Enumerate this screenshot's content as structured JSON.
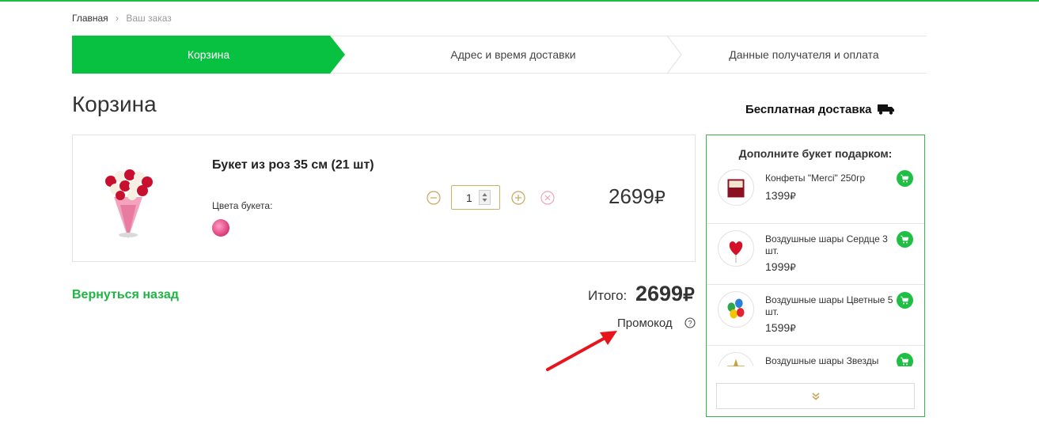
{
  "breadcrumb": {
    "home": "Главная",
    "current": "Ваш заказ"
  },
  "steps": [
    {
      "label": "Корзина",
      "active": true
    },
    {
      "label": "Адрес и время доставки",
      "active": false
    },
    {
      "label": "Данные получателя и оплата",
      "active": false
    }
  ],
  "page_title": "Корзина",
  "cart": {
    "product_name": "Букет из роз 35 см (21 шт)",
    "colors_label": "Цвета букета:",
    "quantity": "1",
    "price": "2699",
    "currency": "₽"
  },
  "footer": {
    "back_link": "Вернуться назад",
    "total_label": "Итого:",
    "total_value": "2699",
    "currency": "₽",
    "promo": "Промокод"
  },
  "delivery": {
    "text": "Бесплатная доставка"
  },
  "gifts": {
    "title": "Дополните букет подарком:",
    "items": [
      {
        "name": "Конфеты \"Merci\" 250гр",
        "price": "1399",
        "icon": "candy-box-icon"
      },
      {
        "name": "Воздушные шары Сердце 3 шт.",
        "price": "1999",
        "icon": "heart-balloons-icon"
      },
      {
        "name": "Воздушные шары Цветные 5 шт.",
        "price": "1599",
        "icon": "color-balloons-icon"
      },
      {
        "name": "Воздушные шары Звезды",
        "price": "",
        "icon": "star-balloons-icon"
      }
    ],
    "currency": "₽"
  },
  "colors": {
    "accent": "#09c140",
    "link_green": "#1fb544",
    "arrow_red": "#e8141c",
    "qty_border": "#c9b36a"
  }
}
